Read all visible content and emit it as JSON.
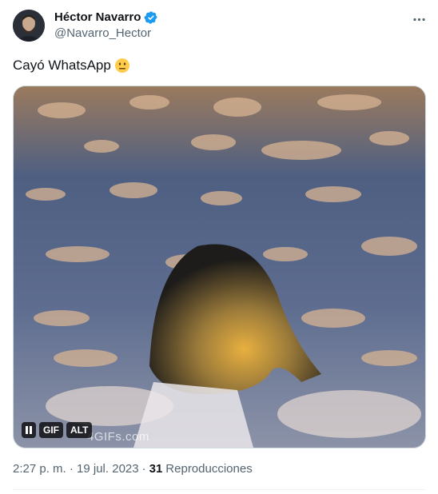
{
  "author": {
    "display_name": "Héctor Navarro",
    "handle": "@Navarro_Hector",
    "verified": true,
    "avatar_icon": "profile-photo"
  },
  "more_icon": "more-horizontal-icon",
  "tweet": {
    "text": "Cayó WhatsApp",
    "emoji": "neutral-face-emoji"
  },
  "media": {
    "type": "gif",
    "watermark": "4GIFs.com",
    "controls": {
      "pause_icon": "pause-icon",
      "gif_label": "GIF",
      "alt_label": "ALT"
    }
  },
  "meta": {
    "timestamp": "2:27 p. m. · 19 jul. 2023",
    "separator": "·",
    "views_count": "31",
    "views_label": "Reproducciones"
  },
  "colors": {
    "verified": "#1d9bf0",
    "secondary_text": "#536471",
    "primary_text": "#0f1419"
  }
}
